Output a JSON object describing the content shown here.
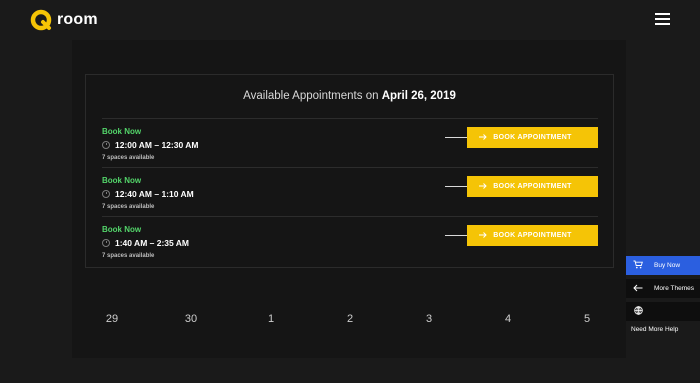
{
  "header": {
    "logo_text": "room",
    "logo_color": "#f5c406"
  },
  "card": {
    "title_prefix": "Available Appointments on",
    "title_date": "April 26, 2019"
  },
  "slots": [
    {
      "book_label": "Book Now",
      "time": "12:00 AM – 12:30 AM",
      "spaces": "7 spaces available",
      "button_label": "BOOK APPOINTMENT"
    },
    {
      "book_label": "Book Now",
      "time": "12:40 AM – 1:10 AM",
      "spaces": "7 spaces available",
      "button_label": "BOOK APPOINTMENT"
    },
    {
      "book_label": "Book Now",
      "time": "1:40 AM – 2:35 AM",
      "spaces": "7 spaces available",
      "button_label": "BOOK APPOINTMENT"
    }
  ],
  "calendar": {
    "days": [
      "29",
      "30",
      "1",
      "2",
      "3",
      "4",
      "5"
    ]
  },
  "sidebar": {
    "buy_now": "Buy Now",
    "more_themes": "More Themes",
    "need_help": "Need More Help"
  },
  "colors": {
    "accent": "#f5c406",
    "book_now": "#53d56a",
    "buy_now_bg": "#2b5fe0",
    "background": "#1a1a1a"
  },
  "icons": {
    "menu": "hamburger-menu-icon",
    "clock": "clock-icon",
    "arrow": "arrow-right-icon",
    "cart": "cart-icon",
    "back": "arrow-left-icon",
    "globe": "globe-icon"
  }
}
